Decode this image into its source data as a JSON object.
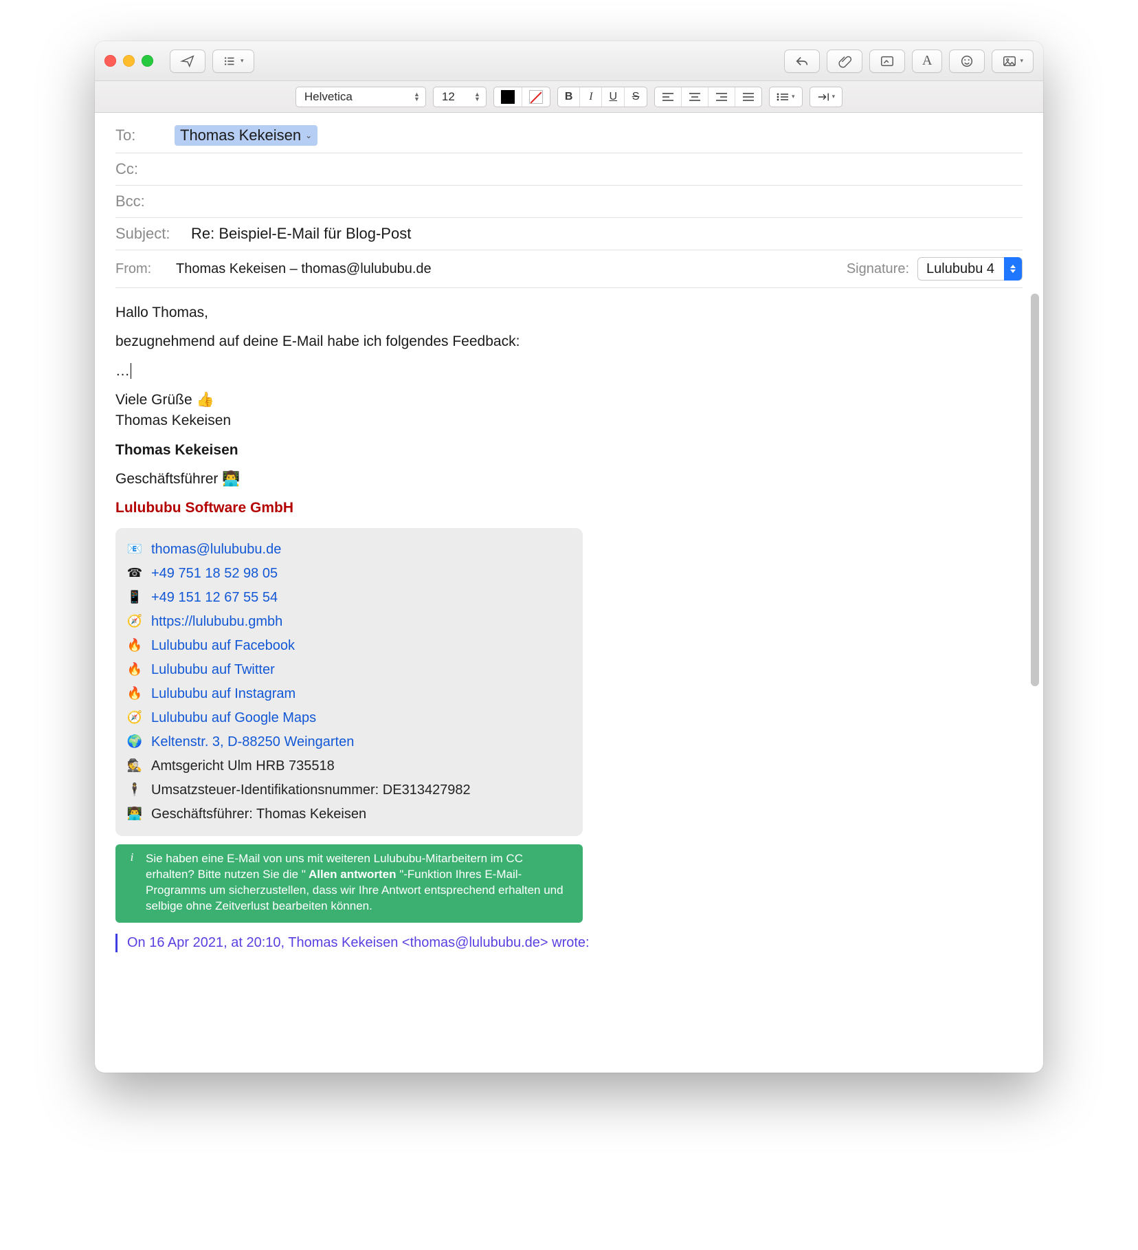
{
  "format": {
    "font": "Helvetica",
    "size": "12"
  },
  "header": {
    "labels": {
      "to": "To:",
      "cc": "Cc:",
      "bcc": "Bcc:",
      "subject": "Subject:",
      "from": "From:",
      "signature": "Signature:"
    },
    "to_token": "Thomas Kekeisen",
    "subject": "Re: Beispiel-E-Mail für Blog-Post",
    "from": "Thomas Kekeisen – thomas@lulububu.de",
    "signature_selected": "Lulububu 4"
  },
  "body": {
    "greeting": "Hallo Thomas,",
    "line1": "bezugnehmend auf deine E-Mail habe ich folgendes Feedback:",
    "dots": "…",
    "closing": "Viele Grüße 👍",
    "closing_name": "Thomas Kekeisen"
  },
  "signature": {
    "name": "Thomas Kekeisen",
    "title": "Geschäftsführer 👨‍💻",
    "company": "Lulububu Software GmbH",
    "rows": [
      {
        "icon": "📧",
        "text": "thomas@lulububu.de",
        "link": true
      },
      {
        "icon": "☎",
        "text": "+49 751 18 52 98 05",
        "link": true
      },
      {
        "icon": "📱",
        "text": "+49 151 12 67 55 54",
        "link": true
      },
      {
        "icon": "🧭",
        "text": "https://lulububu.gmbh",
        "link": true
      },
      {
        "icon": "🔥",
        "text": "Lulububu auf Facebook",
        "link": true
      },
      {
        "icon": "🔥",
        "text": "Lulububu auf Twitter",
        "link": true
      },
      {
        "icon": "🔥",
        "text": "Lulububu auf Instagram",
        "link": true
      },
      {
        "icon": "🧭",
        "text": "Lulububu auf Google Maps",
        "link": true
      },
      {
        "icon": "🌍",
        "text": "Keltenstr. 3, D-88250 Weingarten",
        "link": true
      },
      {
        "icon": "🕵️",
        "text": "Amtsgericht Ulm HRB 735518",
        "link": false
      },
      {
        "icon": "🕴️",
        "text": "Umsatzsteuer-Identifikationsnummer: DE313427982",
        "link": false
      },
      {
        "icon": "👨‍💻",
        "text": "Geschäftsführer: Thomas Kekeisen",
        "link": false
      }
    ]
  },
  "green_note": {
    "pre": "Sie haben eine E-Mail von uns mit weiteren Lulububu-Mitarbeitern im CC erhalten? Bitte nutzen Sie die \"",
    "bold": " Allen antworten ",
    "post": "\"-Funktion Ihres E-Mail-Programms um sicherzustellen, dass wir Ihre Antwort entsprechend erhalten und selbige ohne Zeitverlust bearbeiten können."
  },
  "quote_header": "On 16 Apr 2021, at 20:10, Thomas Kekeisen <thomas@lulububu.de> wrote:"
}
